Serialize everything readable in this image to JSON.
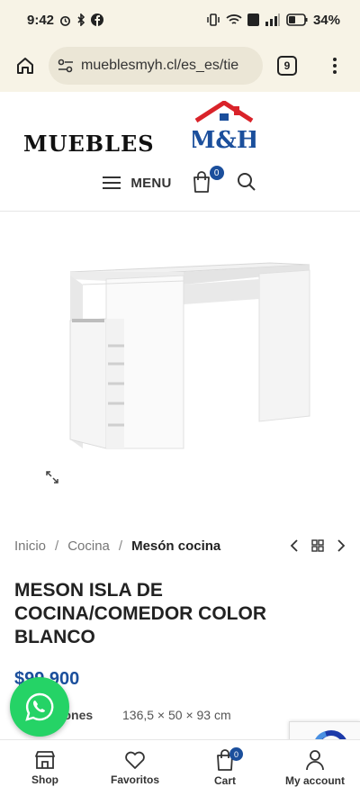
{
  "status_bar": {
    "time": "9:42",
    "battery": "34%",
    "icons": [
      "alarm-icon",
      "bluetooth-icon",
      "facebook-icon",
      "vibrate-icon",
      "wifi-icon",
      "volte-icon",
      "signal-icon",
      "battery-icon"
    ]
  },
  "browser": {
    "url": "mueblesmyh.cl/es_es/tie",
    "tab_count": "9"
  },
  "header": {
    "logo_text": "MUEBLES",
    "logo_mark": "M&H",
    "menu_label": "MENU",
    "cart_count": "0"
  },
  "breadcrumb": {
    "items": [
      "Inicio",
      "Cocina"
    ],
    "current": "Mesón cocina"
  },
  "product": {
    "title": "MESON ISLA DE COCINA/COMEDOR COLOR BLANCO",
    "price": "$99.900",
    "dimensions_label": "Dimensiones",
    "dimensions_value": "136,5 × 50 × 93 cm"
  },
  "bottom_nav": {
    "items": [
      {
        "label": "Shop",
        "icon": "shop-icon"
      },
      {
        "label": "Favoritos",
        "icon": "heart-icon"
      },
      {
        "label": "Cart",
        "icon": "cart-icon",
        "badge": "0"
      },
      {
        "label": "My account",
        "icon": "user-icon"
      }
    ]
  },
  "colors": {
    "accent": "#1b4f9c",
    "logo_red": "#d9232a",
    "whatsapp": "#25d366",
    "browser_bg": "#f7f3e6"
  }
}
